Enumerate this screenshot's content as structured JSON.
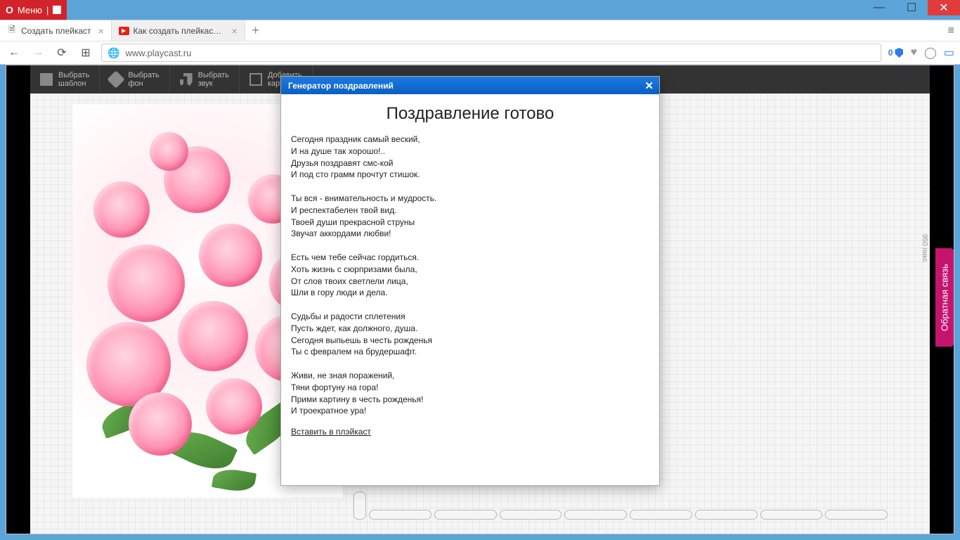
{
  "window": {
    "menu_label": "Меню"
  },
  "tabs": [
    {
      "label": "Создать плейкаст",
      "active": true,
      "favicon": "file"
    },
    {
      "label": "Как создать плейкаст - Yo",
      "active": false,
      "favicon": "youtube"
    }
  ],
  "address": {
    "url": "www.playcast.ru",
    "badge_count": "0"
  },
  "toolbar": {
    "template": "Выбрать\nшаблон",
    "background": "Выбрать\nфон",
    "sound": "Выбрать\nзвук",
    "image": "Добавить\nкартинку"
  },
  "dialog": {
    "title": "Генератор поздравлений",
    "heading": "Поздравление готово",
    "poem": "Сегодня праздник самый веский,\nИ на душе так хорошо!..\nДрузья поздравят смс-кой\nИ под сто грамм прочтут стишок.\n\nТы вся - внимательность и мудрость.\nИ респектабелен твой вид.\nТвоей души прекрасной струны\nЗвучат аккордами любви!\n\nЕсть чем тебе сейчас гордиться.\nХоть жизнь с сюрпризами была,\nОт слов твоих светлели лица,\nШли в гору люди и дела.\n\nСудьбы и радости сплетения\nПусть ждет, как должного, душа.\nСегодня выпьешь в честь рожденья\nТы с февралем на брудершафт.\n\nЖиви, не зная поражений,\nТяни фортуну на гора!\nПрими картину в честь рожденья!\nИ троекратное ура!",
    "insert_link": "Вставить в плэйкаст"
  },
  "feedback_label": "Обратная связь",
  "ruler_label": "950 пикс"
}
